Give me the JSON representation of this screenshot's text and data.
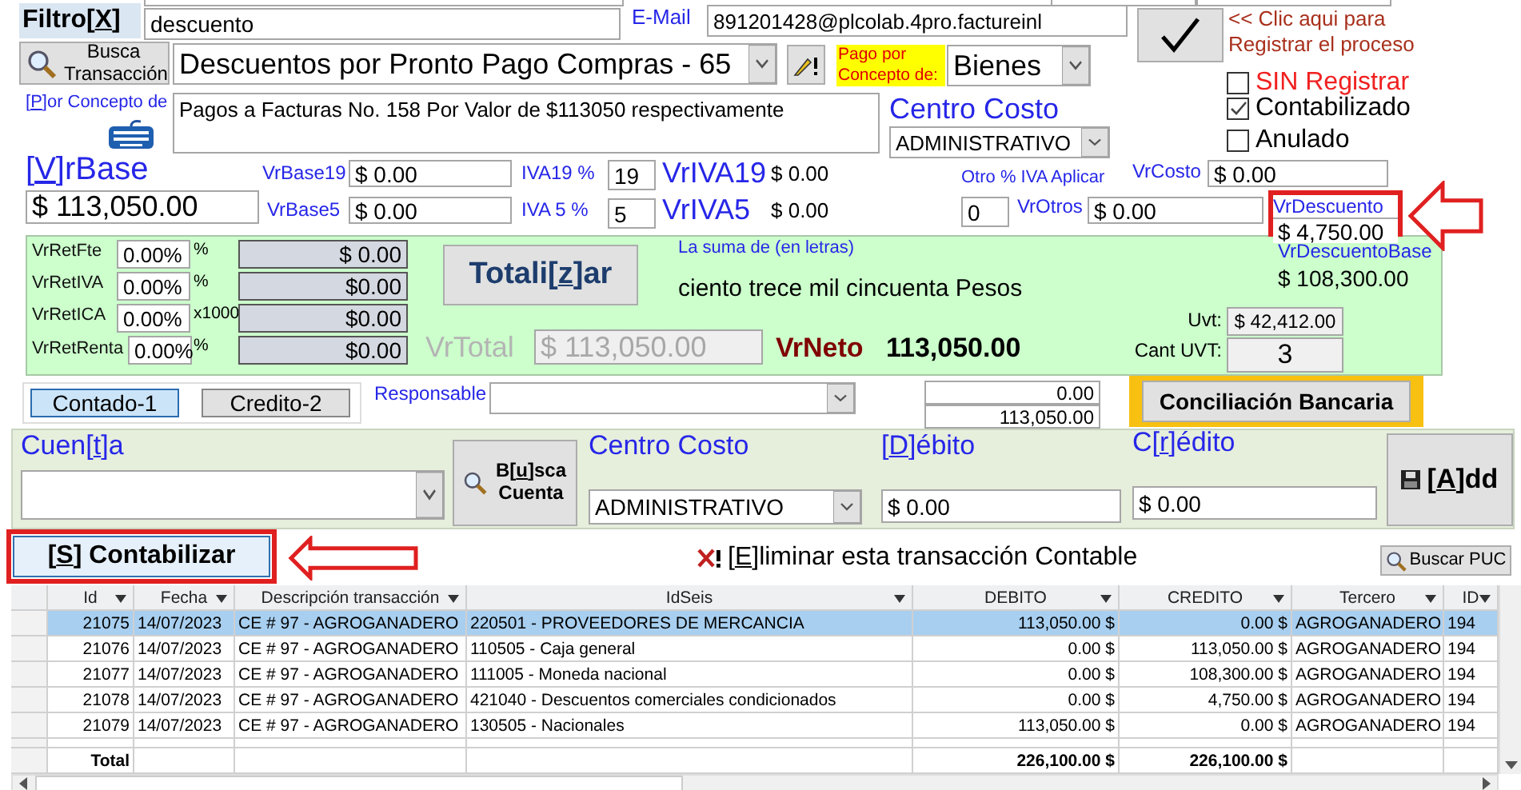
{
  "filter": {
    "label": "Filtro[X]",
    "value": "descuento"
  },
  "email": {
    "label": "E-Mail",
    "value": "891201428@plcolab.4pro.factureinl"
  },
  "search_transaction_button": "Busca Transacción",
  "transaction_type": "Descuentos por Pronto Pago Compras - 65",
  "payment_concept": {
    "label": "Pago por Concepto de:",
    "value": "Bienes"
  },
  "register_hint": "<< Clic aqui para Registrar el proceso",
  "status_checks": [
    {
      "label": "SIN Registrar",
      "checked": false
    },
    {
      "label": "Contabilizado",
      "checked": true
    },
    {
      "label": "Anulado",
      "checked": false
    }
  ],
  "concept": {
    "label": "[P]or Concepto de",
    "value": "Pagos a Facturas No. 158 Por Valor de $113050 respectivamente"
  },
  "cost_center": {
    "label": "Centro Costo",
    "value": "ADMINISTRATIVO"
  },
  "base": {
    "label": "[V]rBase",
    "value": "$ 113,050.00"
  },
  "base19": {
    "label": "VrBase19",
    "value": "$ 0.00"
  },
  "base5": {
    "label": "VrBase5",
    "value": "$ 0.00"
  },
  "iva19": {
    "label": "IVA19 %",
    "value": "19",
    "total_label": "VrIVA19",
    "total": "$ 0.00"
  },
  "iva5": {
    "label": "IVA 5 %",
    "value": "5",
    "total_label": "VrIVA5",
    "total": "$ 0.00"
  },
  "other_iva": {
    "label": "Otro % IVA Aplicar",
    "value": "0"
  },
  "cost": {
    "label": "VrCosto",
    "value": "$ 0.00"
  },
  "others": {
    "label": "VrOtros",
    "value": "$ 0.00"
  },
  "discount": {
    "label": "VrDescuento",
    "value": "$ 4,750.00"
  },
  "retentions": [
    {
      "label": "VrRetFte",
      "rate": "0.00%",
      "unit": "%",
      "amount": "$ 0.00"
    },
    {
      "label": "VrRetIVA",
      "rate": "0.00%",
      "unit": "%",
      "amount": "$0.00"
    },
    {
      "label": "VrRetICA",
      "rate": "0.00%",
      "unit": "x1000",
      "amount": "$0.00"
    },
    {
      "label": "VrRetRenta",
      "rate": "0.00%",
      "unit": "%",
      "amount": "$0.00"
    }
  ],
  "totalize_button": "Totali[z]ar",
  "amount_in_words": {
    "label": "La suma de (en letras)",
    "value": "ciento trece mil cincuenta Pesos"
  },
  "total": {
    "label": "VrTotal",
    "value": "$ 113,050.00",
    "disabled": true
  },
  "net": {
    "label": "VrNeto",
    "value": "113,050.00"
  },
  "discount_base": {
    "label": "VrDescuentoBase",
    "value": "$ 108,300.00"
  },
  "uvt": {
    "label": "Uvt:",
    "value": "$ 42,412.00"
  },
  "uvt_count": {
    "label": "Cant UVT:",
    "value": "3"
  },
  "payment_options": [
    {
      "label": "Contado-1",
      "selected": true
    },
    {
      "label": "Credito-2",
      "selected": false
    }
  ],
  "responsible": {
    "label": "Responsable"
  },
  "balances": [
    "0.00",
    "113,050.00"
  ],
  "reconciliation_button": "Conciliación Bancaria",
  "entry": {
    "account_label": "Cuen[t]a",
    "search_account_button": "B[u]sca Cuenta",
    "cost_center_label": "Centro Costo",
    "cost_center": "ADMINISTRATIVO",
    "debit_label": "[D]ébito",
    "debit": "$ 0.00",
    "credit_label": "C[r]édito",
    "credit": "$ 0.00",
    "add_button": "[A]dd"
  },
  "post_button": "[S] Contabilizar",
  "delete_link": "[E]liminar esta transacción Contable",
  "find_puc_button": "Buscar PUC",
  "grid": {
    "columns": [
      "Id",
      "Fecha",
      "Descripción transacción",
      "IdSeis",
      "DEBITO",
      "CREDITO",
      "Tercero",
      "ID"
    ],
    "rows": [
      {
        "selected": true,
        "cells": [
          "21075",
          "14/07/2023",
          "CE # 97 - AGROGANADERO",
          "220501 - PROVEEDORES DE MERCANCIA",
          "113,050.00 $",
          "0.00 $",
          "AGROGANADERO",
          "194"
        ]
      },
      {
        "selected": false,
        "cells": [
          "21076",
          "14/07/2023",
          "CE # 97 - AGROGANADERO",
          "110505 - Caja general",
          "0.00 $",
          "113,050.00 $",
          "AGROGANADERO",
          "194"
        ]
      },
      {
        "selected": false,
        "cells": [
          "21077",
          "14/07/2023",
          "CE # 97 - AGROGANADERO",
          "111005 - Moneda nacional",
          "0.00 $",
          "108,300.00 $",
          "AGROGANADERO",
          "194"
        ]
      },
      {
        "selected": false,
        "cells": [
          "21078",
          "14/07/2023",
          "CE # 97 - AGROGANADERO",
          "421040 - Descuentos comerciales condicionados",
          "0.00 $",
          "4,750.00 $",
          "AGROGANADERO",
          "194"
        ]
      },
      {
        "selected": false,
        "cells": [
          "21079",
          "14/07/2023",
          "CE # 97 - AGROGANADERO",
          "130505 - Nacionales",
          "113,050.00 $",
          "0.00 $",
          "AGROGANADERO",
          "194"
        ]
      }
    ],
    "total": {
      "label": "Total",
      "debit": "226,100.00 $",
      "credit": "226,100.00 $"
    }
  }
}
